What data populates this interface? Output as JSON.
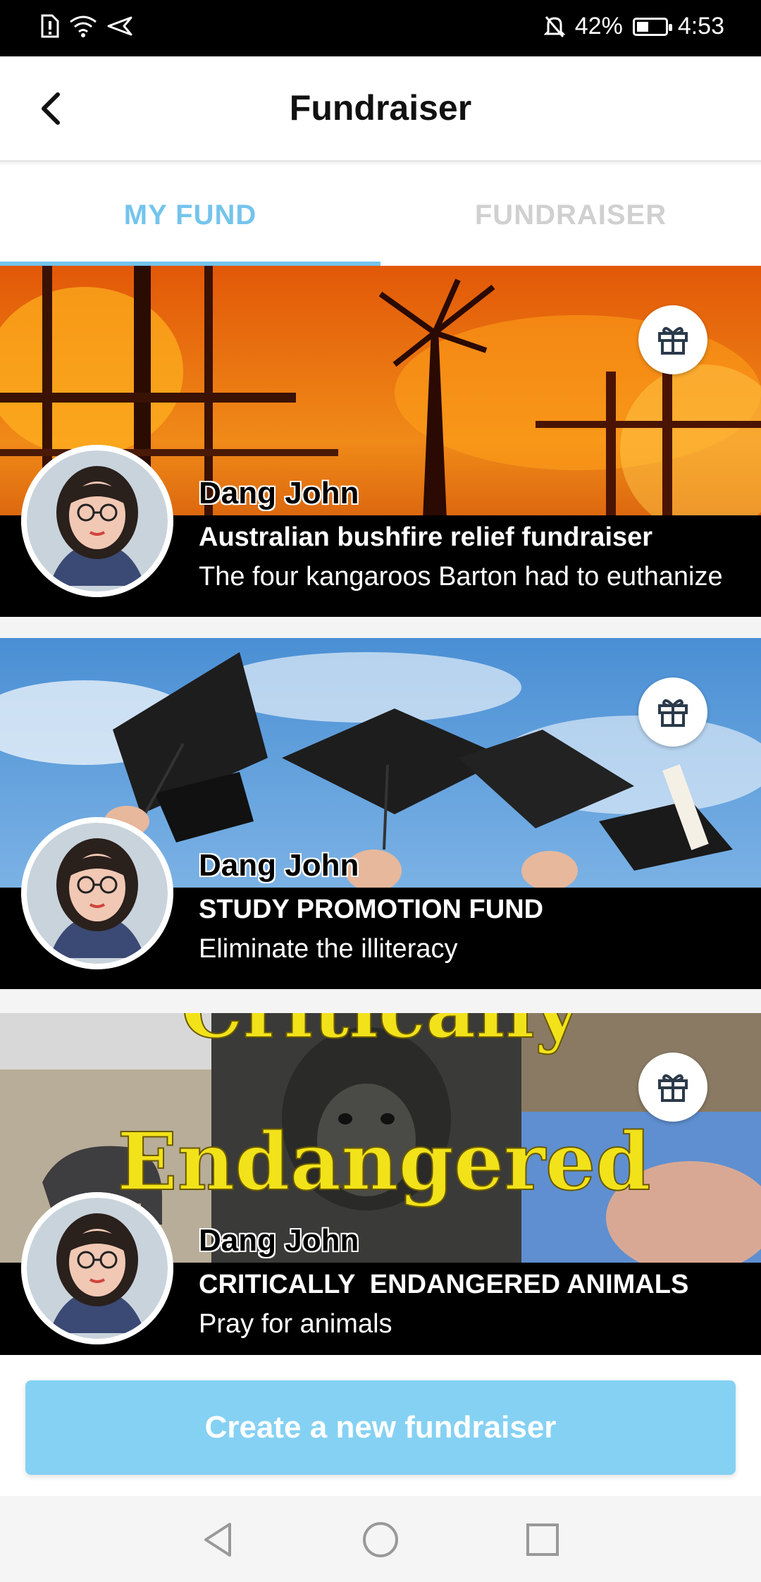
{
  "status_bar": {
    "battery": "42%",
    "time": "4:53",
    "battery_level": 0.42
  },
  "header": {
    "title": "Fundraiser"
  },
  "tabs": [
    {
      "label": "MY FUND",
      "active": true
    },
    {
      "label": "FUNDRAISER",
      "active": false
    }
  ],
  "funds": [
    {
      "owner": "Dang John",
      "title": "Australian bushfire relief fundraiser",
      "description": "The four kangaroos Barton had to euthanize"
    },
    {
      "owner": "Dang John",
      "title": "STUDY PROMOTION FUND",
      "description": "Eliminate the illiteracy"
    },
    {
      "owner": "Dang John",
      "title": "CRITICALLY  ENDANGERED ANIMALS",
      "description": "Pray for animals"
    }
  ],
  "banner_text": {
    "line1": "Critically",
    "line2": "Endangered"
  },
  "create_button": {
    "label": "Create a new fundraiser"
  },
  "colors": {
    "accent": "#74c4ec",
    "button": "#85d1f3"
  }
}
